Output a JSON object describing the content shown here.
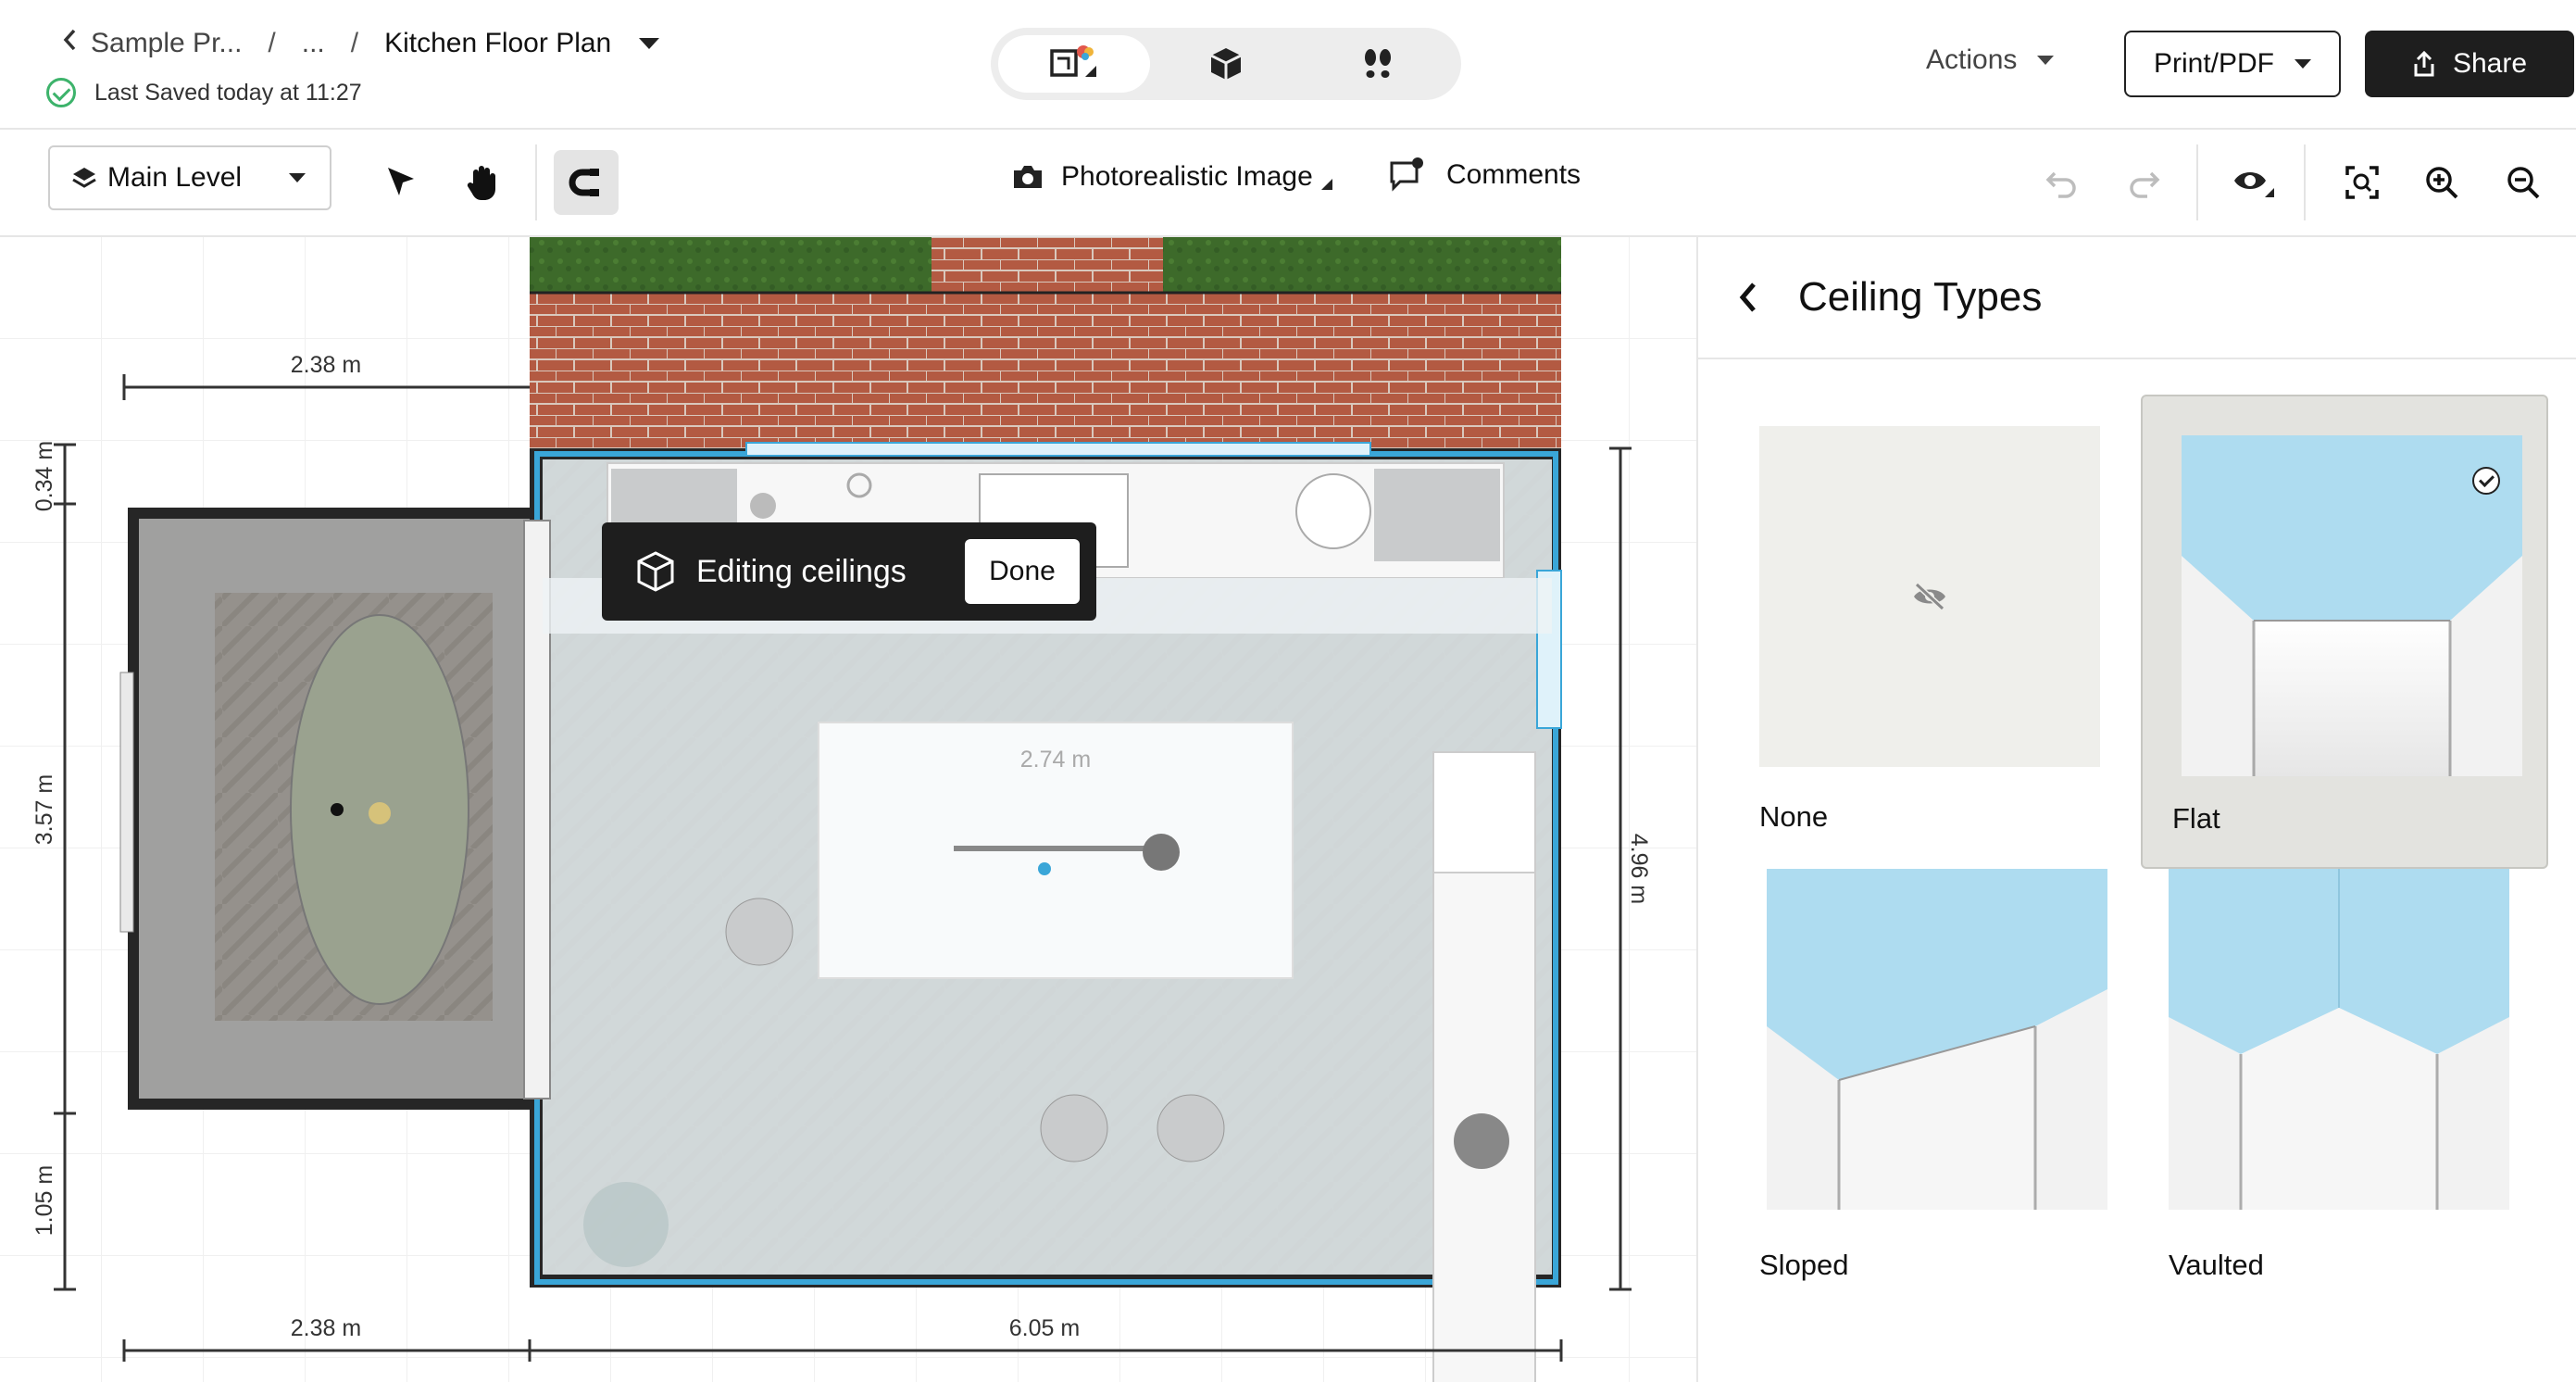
{
  "header": {
    "back_label": "Sample Pr...",
    "ellipsis": "...",
    "separator": "/",
    "title": "Kitchen Floor Plan",
    "saved_status": "Last Saved today at 11:27",
    "actions_label": "Actions",
    "print_label": "Print/PDF",
    "share_label": "Share",
    "view_modes": [
      {
        "name": "2d-floorplan",
        "active": true
      },
      {
        "name": "3d-view",
        "active": false
      },
      {
        "name": "walkthrough",
        "active": false
      }
    ]
  },
  "toolbar": {
    "level_label": "Main Level",
    "photo_label": "Photorealistic Image",
    "comments_label": "Comments"
  },
  "canvas": {
    "editing_banner": "Editing ceilings",
    "done_label": "Done",
    "dimensions": {
      "top_left_width": "2.38 m",
      "left_top": "0.34 m",
      "left_middle": "3.57 m",
      "left_bottom": "1.05 m",
      "right_height": "4.96 m",
      "bottom_left": "2.38 m",
      "bottom_right": "6.05 m",
      "island_width": "2.74 m"
    }
  },
  "panel": {
    "title": "Ceiling Types",
    "options": [
      {
        "label": "None",
        "selected": false
      },
      {
        "label": "Flat",
        "selected": true
      },
      {
        "label": "Sloped",
        "selected": false
      },
      {
        "label": "Vaulted",
        "selected": false
      }
    ]
  },
  "colors": {
    "accent_blue": "#3aa6d8",
    "dark": "#1e1e1e",
    "grass": "#3f6b2c",
    "brick": "#b0553f",
    "ceiling_blue": "#aedcf0"
  }
}
